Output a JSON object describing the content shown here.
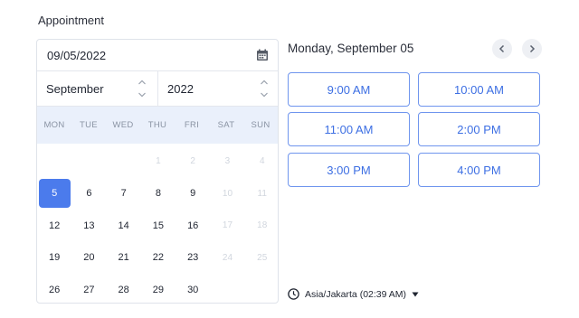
{
  "section": {
    "title": "Appointment"
  },
  "calendar": {
    "date_value": "09/05/2022",
    "month_selected": "September",
    "year_selected": "2022",
    "weekdays": [
      "MON",
      "TUE",
      "WED",
      "THU",
      "FRI",
      "SAT",
      "SUN"
    ],
    "weeks": [
      [
        {
          "d": ""
        },
        {
          "d": ""
        },
        {
          "d": ""
        },
        {
          "d": "1",
          "muted": true
        },
        {
          "d": "2",
          "muted": true
        },
        {
          "d": "3",
          "muted": true
        },
        {
          "d": "4",
          "muted": true
        }
      ],
      [
        {
          "d": "5",
          "selected": true
        },
        {
          "d": "6"
        },
        {
          "d": "7"
        },
        {
          "d": "8"
        },
        {
          "d": "9"
        },
        {
          "d": "10",
          "muted": true
        },
        {
          "d": "11",
          "muted": true
        }
      ],
      [
        {
          "d": "12"
        },
        {
          "d": "13"
        },
        {
          "d": "14"
        },
        {
          "d": "15"
        },
        {
          "d": "16"
        },
        {
          "d": "17",
          "muted": true
        },
        {
          "d": "18",
          "muted": true
        }
      ],
      [
        {
          "d": "19"
        },
        {
          "d": "20"
        },
        {
          "d": "21"
        },
        {
          "d": "22"
        },
        {
          "d": "23"
        },
        {
          "d": "24",
          "muted": true
        },
        {
          "d": "25",
          "muted": true
        }
      ],
      [
        {
          "d": "26"
        },
        {
          "d": "27"
        },
        {
          "d": "28"
        },
        {
          "d": "29"
        },
        {
          "d": "30"
        },
        {
          "d": ""
        },
        {
          "d": ""
        }
      ]
    ],
    "icons": {
      "date": "calendar-icon",
      "stepper": "up-down-chevron-icon"
    }
  },
  "schedule": {
    "heading": "Monday, September 05",
    "prev_icon": "chevron-left-icon",
    "next_icon": "chevron-right-icon",
    "slots": [
      "9:00 AM",
      "10:00 AM",
      "11:00 AM",
      "2:00 PM",
      "3:00 PM",
      "4:00 PM"
    ],
    "timezone": "Asia/Jakarta (02:39 AM)",
    "timezone_icon": "clock-icon"
  },
  "colors": {
    "accent": "#4b7bec",
    "slot_border": "#6f95ee",
    "weekday_bg": "#eaf0fb",
    "muted": "#d1d6de"
  }
}
